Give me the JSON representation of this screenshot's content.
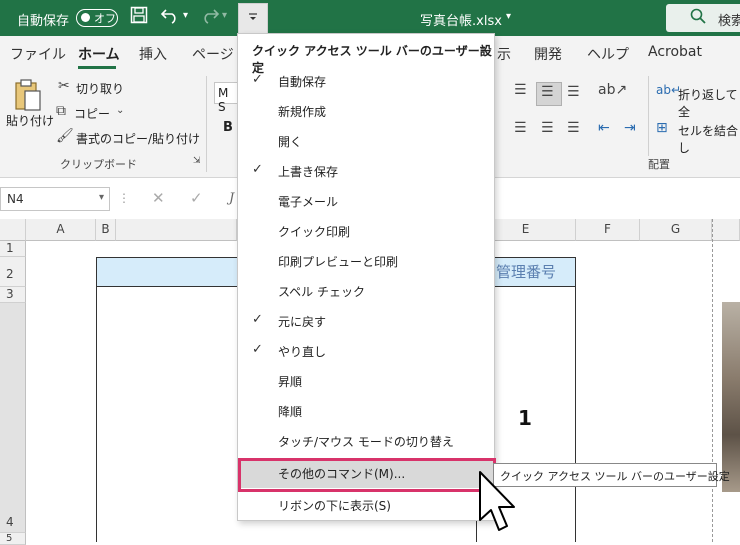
{
  "titlebar": {
    "autosave_label": "自動保存",
    "autosave_toggle": "オフ",
    "filename": "写真台帳.xlsx",
    "search_label": "検索"
  },
  "tabs": [
    "ファイル",
    "ホーム",
    "挿入",
    "ページ",
    "示",
    "開発",
    "ヘルプ",
    "Acrobat"
  ],
  "ribbon": {
    "paste_label": "貼り付け",
    "cut_label": "切り取り",
    "copy_label": "コピー",
    "format_painter_label": "書式のコピー/貼り付け",
    "clipboard_group": "クリップボード",
    "font_box": "M S",
    "bold": "B",
    "wrap_text_label": "折り返して全",
    "merge_label": "セルを結合し",
    "alignment_group": "配置"
  },
  "formula_bar": {
    "name_box": "N4",
    "fx": "J"
  },
  "grid": {
    "columns": [
      "A",
      "B",
      "E",
      "F",
      "G"
    ],
    "rows": [
      "1",
      "2",
      "3",
      "4",
      "5"
    ],
    "e2_value": "管理番号",
    "e4_value": "1"
  },
  "menu": {
    "header": "クイック アクセス ツール バーのユーザー設定",
    "items": [
      {
        "label": "自動保存",
        "checked": "✓"
      },
      {
        "label": "新規作成",
        "checked": ""
      },
      {
        "label": "開く",
        "checked": ""
      },
      {
        "label": "上書き保存",
        "checked": "✓"
      },
      {
        "label": "電子メール",
        "checked": ""
      },
      {
        "label": "クイック印刷",
        "checked": ""
      },
      {
        "label": "印刷プレビューと印刷",
        "checked": ""
      },
      {
        "label": "スペル チェック",
        "checked": ""
      },
      {
        "label": "元に戻す",
        "checked": "✓"
      },
      {
        "label": "やり直し",
        "checked": "✓"
      },
      {
        "label": "昇順",
        "checked": ""
      },
      {
        "label": "降順",
        "checked": ""
      },
      {
        "label": "タッチ/マウス モードの切り替え",
        "checked": ""
      },
      {
        "label": "その他のコマンド(M)...",
        "checked": ""
      },
      {
        "label": "リボンの下に表示(S)",
        "checked": ""
      }
    ]
  },
  "tooltip": "クイック アクセス ツール バーのユーザー設定",
  "colors": {
    "excel_green": "#217346",
    "highlight_border": "#d8336a",
    "header_fill": "#d6ecfa"
  }
}
